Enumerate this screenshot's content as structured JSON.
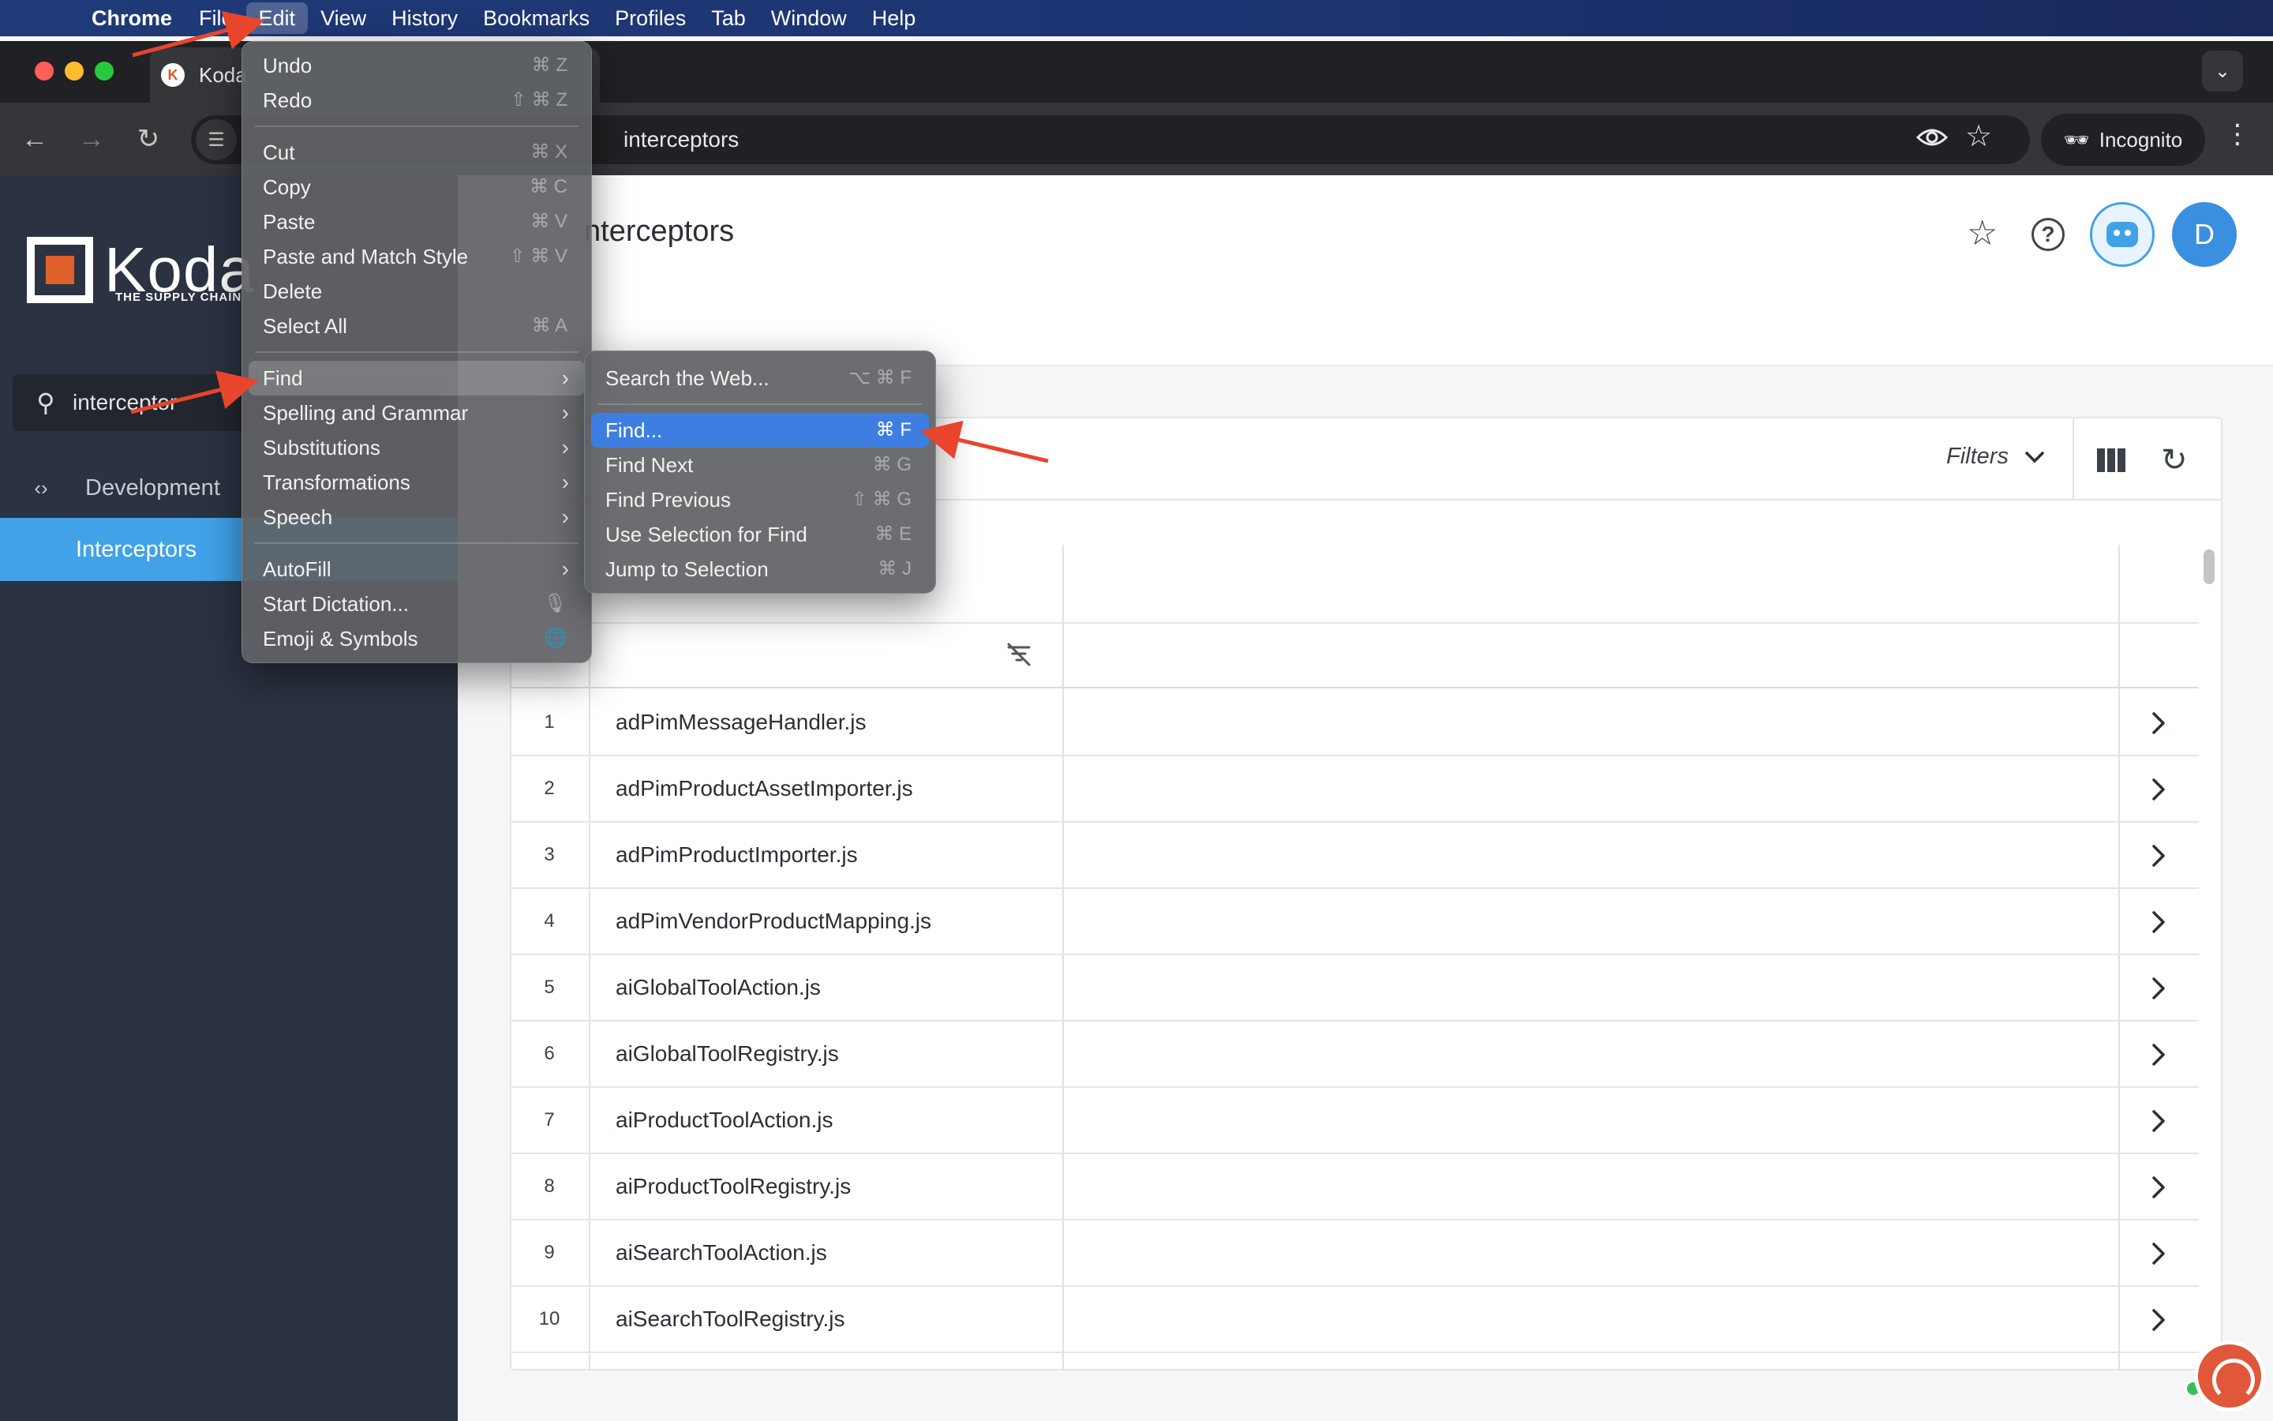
{
  "menubar": {
    "app": "Chrome",
    "items": [
      "File",
      "Edit",
      "View",
      "History",
      "Bookmarks",
      "Profiles",
      "Tab",
      "Window",
      "Help"
    ],
    "active": "Edit"
  },
  "browser": {
    "tab_title": "Koda",
    "url_text": "interceptors",
    "incognito_label": "Incognito"
  },
  "sidebar": {
    "logo_word": "Koda",
    "logo_subtitle": "THE SUPPLY CHAIN",
    "search_value": "interceptor",
    "nav": [
      {
        "label": "Development",
        "icon": "code-icon"
      },
      {
        "label": "Interceptors",
        "selected": true
      }
    ],
    "accent_color": "#42a2e8"
  },
  "header": {
    "title": "nterceptors",
    "avatar_letter": "D"
  },
  "grid": {
    "filters_label": "Filters",
    "rows": [
      {
        "num": "1",
        "name": "adPimMessageHandler.js"
      },
      {
        "num": "2",
        "name": "adPimProductAssetImporter.js"
      },
      {
        "num": "3",
        "name": "adPimProductImporter.js"
      },
      {
        "num": "4",
        "name": "adPimVendorProductMapping.js"
      },
      {
        "num": "5",
        "name": "aiGlobalToolAction.js"
      },
      {
        "num": "6",
        "name": "aiGlobalToolRegistry.js"
      },
      {
        "num": "7",
        "name": "aiProductToolAction.js"
      },
      {
        "num": "8",
        "name": "aiProductToolRegistry.js"
      },
      {
        "num": "9",
        "name": "aiSearchToolAction.js"
      },
      {
        "num": "10",
        "name": "aiSearchToolRegistry.js"
      }
    ]
  },
  "edit_menu": {
    "groups": [
      [
        {
          "label": "Undo",
          "shortcut": "⌘ Z"
        },
        {
          "label": "Redo",
          "shortcut": "⇧ ⌘ Z"
        }
      ],
      [
        {
          "label": "Cut",
          "shortcut": "⌘ X"
        },
        {
          "label": "Copy",
          "shortcut": "⌘ C"
        },
        {
          "label": "Paste",
          "shortcut": "⌘ V"
        },
        {
          "label": "Paste and Match Style",
          "shortcut": "⇧ ⌘ V"
        },
        {
          "label": "Delete",
          "shortcut": ""
        },
        {
          "label": "Select All",
          "shortcut": "⌘ A"
        }
      ],
      [
        {
          "label": "Find",
          "submenu": true,
          "highlighted": true
        },
        {
          "label": "Spelling and Grammar",
          "submenu": true
        },
        {
          "label": "Substitutions",
          "submenu": true
        },
        {
          "label": "Transformations",
          "submenu": true
        },
        {
          "label": "Speech",
          "submenu": true
        }
      ],
      [
        {
          "label": "AutoFill",
          "submenu": true
        },
        {
          "label": "Start Dictation...",
          "shortcut": "🎙"
        },
        {
          "label": "Emoji & Symbols",
          "shortcut": "🌐"
        }
      ]
    ]
  },
  "find_submenu": {
    "groups": [
      [
        {
          "label": "Search the Web...",
          "shortcut": "⌥ ⌘ F"
        }
      ],
      [
        {
          "label": "Find...",
          "shortcut": "⌘ F",
          "selected": true
        },
        {
          "label": "Find Next",
          "shortcut": "⌘ G"
        },
        {
          "label": "Find Previous",
          "shortcut": "⇧ ⌘ G"
        },
        {
          "label": "Use Selection for Find",
          "shortcut": "⌘ E"
        },
        {
          "label": "Jump to Selection",
          "shortcut": "⌘ J"
        }
      ]
    ]
  },
  "colors": {
    "menu_selection": "#3d7ee0",
    "annotation_arrow": "#e8452c"
  }
}
